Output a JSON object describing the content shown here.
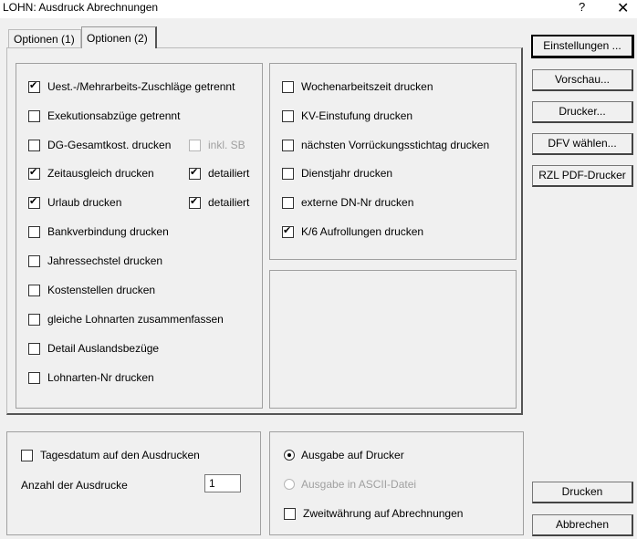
{
  "window": {
    "title": "LOHN: Ausdruck Abrechnungen",
    "help": "?",
    "close": "✕"
  },
  "tabs": [
    {
      "label": "Optionen (1)"
    },
    {
      "label": "Optionen (2)"
    }
  ],
  "left_options": [
    {
      "label": "Uest.-/Mehrarbeits-Zuschläge getrennt",
      "checked": true
    },
    {
      "label": "Exekutionsabzüge getrennt",
      "checked": false
    },
    {
      "label": "DG-Gesamtkost. drucken",
      "checked": false
    },
    {
      "label": "Zeitausgleich drucken",
      "checked": true
    },
    {
      "label": "Urlaub drucken",
      "checked": true
    },
    {
      "label": "Bankverbindung drucken",
      "checked": false
    },
    {
      "label": "Jahressechstel drucken",
      "checked": false
    },
    {
      "label": "Kostenstellen drucken",
      "checked": false
    },
    {
      "label": "gleiche Lohnarten zusammenfassen",
      "checked": false
    },
    {
      "label": "Detail Auslandsbezüge",
      "checked": false
    },
    {
      "label": "Lohnarten-Nr drucken",
      "checked": false
    }
  ],
  "sub_options": [
    {
      "label": "inkl. SB",
      "checked": false,
      "disabled": true
    },
    {
      "label": "detailiert",
      "checked": true,
      "disabled": false
    },
    {
      "label": "detailiert",
      "checked": true,
      "disabled": false
    }
  ],
  "right_options": [
    {
      "label": "Wochenarbeitszeit drucken",
      "checked": false
    },
    {
      "label": "KV-Einstufung drucken",
      "checked": false
    },
    {
      "label": "nächsten Vorrückungsstichtag drucken",
      "checked": false
    },
    {
      "label": "Dienstjahr drucken",
      "checked": false
    },
    {
      "label": "externe DN-Nr drucken",
      "checked": false
    },
    {
      "label": "K/6 Aufrollungen drucken",
      "checked": true
    }
  ],
  "bottom_left": {
    "tagesdatum": {
      "label": "Tagesdatum auf den Ausdrucken",
      "checked": false
    },
    "anzahl_label": "Anzahl der Ausdrucke",
    "anzahl_value": "1"
  },
  "bottom_right": {
    "radio_drucker": {
      "label": "Ausgabe auf Drucker",
      "selected": true
    },
    "radio_ascii": {
      "label": "Ausgabe in ASCII-Datei",
      "selected": false,
      "disabled": true
    },
    "zweitwaehrung": {
      "label": "Zweitwährung auf Abrechnungen",
      "checked": false
    }
  },
  "buttons": {
    "einstellungen": "Einstellungen ...",
    "vorschau": "Vorschau...",
    "drucker": "Drucker...",
    "dfv": "DFV wählen...",
    "rzl": "RZL PDF-Drucker",
    "drucken": "Drucken",
    "abbrechen": "Abbrechen"
  }
}
